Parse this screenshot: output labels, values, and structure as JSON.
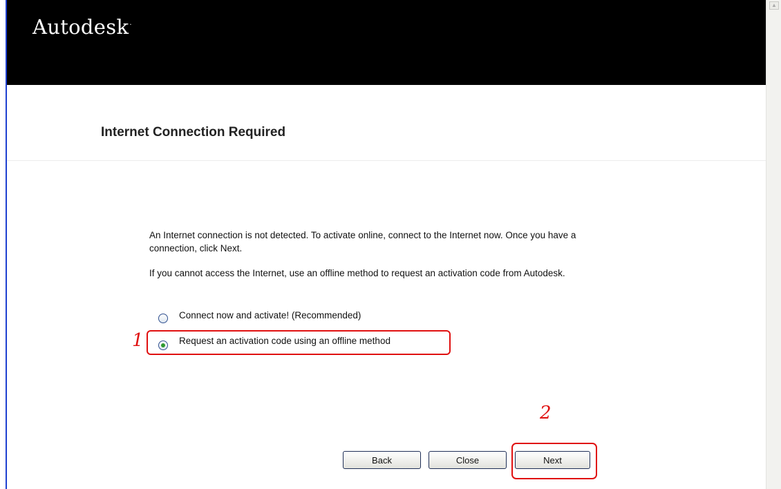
{
  "header": {
    "brand": "Autodesk",
    "brand_mark": "."
  },
  "page": {
    "title": "Internet Connection Required"
  },
  "body": {
    "paragraph1": "An Internet connection is not detected. To activate online, connect to the Internet now. Once you have a connection, click Next.",
    "paragraph2": "If you cannot access the Internet, use an offline method to request an activation code from Autodesk."
  },
  "options": [
    {
      "label": "Connect now and activate! (Recommended)",
      "selected": false
    },
    {
      "label": "Request an activation code using an offline method",
      "selected": true
    }
  ],
  "buttons": {
    "back": "Back",
    "close": "Close",
    "next": "Next"
  },
  "annotations": {
    "step1": "1",
    "step2": "2",
    "color": "#e01010"
  },
  "colors": {
    "header_bg": "#000000",
    "accent_edge": "#1d3fd0",
    "radio_selected": "#2f9a2f"
  }
}
